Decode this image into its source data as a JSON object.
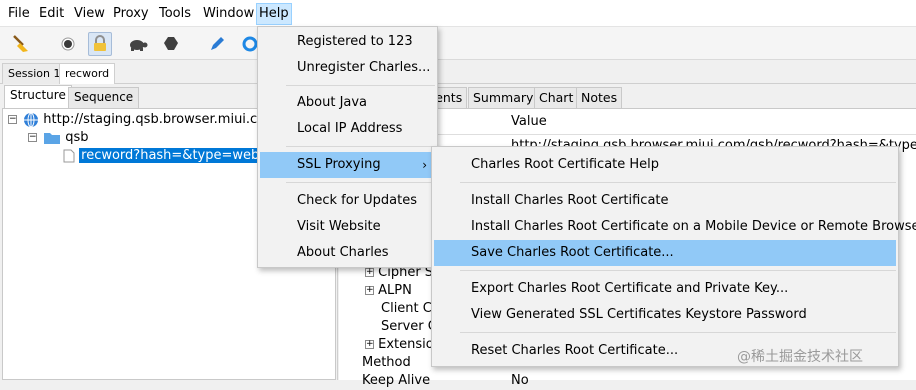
{
  "menubar": {
    "file": "File",
    "edit": "Edit",
    "view": "View",
    "proxy": "Proxy",
    "tools": "Tools",
    "window": "Window",
    "help": "Help"
  },
  "sessions": {
    "session1": "Session 1",
    "recword": "recword"
  },
  "left_tabs": {
    "structure": "Structure",
    "sequence": "Sequence"
  },
  "tree": {
    "host": "http://staging.qsb.browser.miui.com",
    "folder": "qsb",
    "selected": "recword?hash=&type=web_al"
  },
  "right_tabs": {
    "contents": "Contents",
    "summary": "Summary",
    "chart": "Chart",
    "notes": "Notes"
  },
  "grid": {
    "value_header": "Value",
    "first_value": "http://staging.qsb.browser.miui.com/qsb/recword?hash=&type=web_",
    "rows": [
      "Cipher S",
      "ALPN",
      "Client Ce",
      "Server C",
      "Extensio",
      "Method",
      "Keep Alive"
    ],
    "last_value": "No"
  },
  "help_menu": {
    "registered": "Registered to 123",
    "unregister": "Unregister Charles...",
    "about_java": "About Java",
    "local_ip": "Local IP Address",
    "ssl_proxying": "SSL Proxying",
    "check_updates": "Check for Updates",
    "visit_website": "Visit Website",
    "about_charles": "About Charles"
  },
  "ssl_submenu": {
    "root_help": "Charles Root Certificate Help",
    "install_root": "Install Charles Root Certificate",
    "install_mobile": "Install Charles Root Certificate on a Mobile Device or Remote Browser",
    "save_root": "Save Charles Root Certificate...",
    "export_root": "Export Charles Root Certificate and Private Key...",
    "view_keystore": "View Generated SSL Certificates Keystore Password",
    "reset_root": "Reset Charles Root Certificate..."
  },
  "watermark": "@稀土掘金技术社区",
  "colors": {
    "highlight": "#91c9f7",
    "selection": "#0078d7",
    "menubar_active": "#cce8ff"
  }
}
